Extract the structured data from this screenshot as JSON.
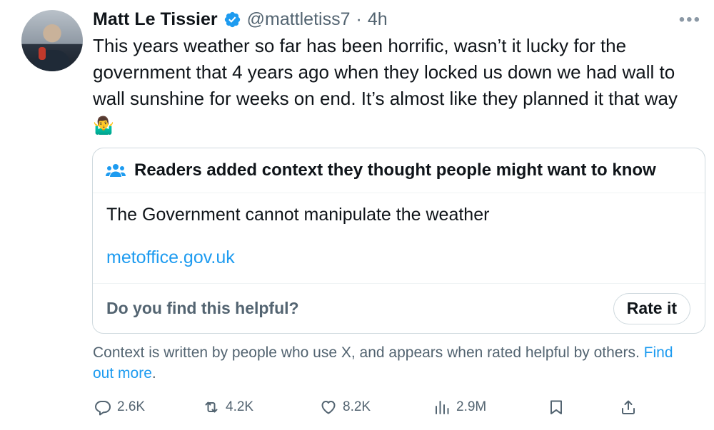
{
  "author": {
    "name": "Matt Le Tissier",
    "handle": "@mattletiss7",
    "separator": "·",
    "time": "4h"
  },
  "tweet": {
    "text": "This years weather so far has been horrific, wasn’t it lucky for the government that 4 years ago when they locked us down we had wall to wall sunshine for weeks on end. It’s almost like they planned it that way",
    "emoji": "🤷‍♂️"
  },
  "community_note": {
    "header": "Readers added context they thought people might want to know",
    "text": "The Government cannot manipulate the weather",
    "link": "metoffice.gov.uk",
    "question": "Do you find this helpful?",
    "rate_label": "Rate it"
  },
  "context_footer": {
    "text": "Context is written by people who use X, and appears when rated helpful by others.",
    "link": "Find out more",
    "trailing": "."
  },
  "actions": {
    "replies": "2.6K",
    "reposts": "4.2K",
    "likes": "8.2K",
    "views": "2.9M"
  },
  "colors": {
    "text": "#0f1419",
    "secondary": "#536471",
    "link": "#1d9bf0",
    "verified": "#1d9bf0",
    "border": "#cfd9de"
  },
  "icons": [
    "verified-badge-icon",
    "more-icon",
    "people-icon",
    "reply-icon",
    "repost-icon",
    "like-icon",
    "views-icon",
    "bookmark-icon",
    "share-icon"
  ]
}
